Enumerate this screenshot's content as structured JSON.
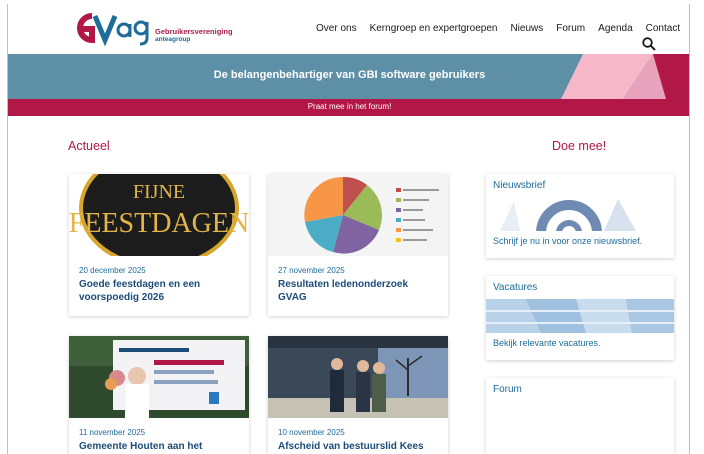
{
  "header": {
    "logo_sub1": "Gebruikersvereniging",
    "logo_sub2": "anteagroup",
    "nav": [
      "Over ons",
      "Kerngroep en expertgroepen",
      "Nieuws",
      "Forum",
      "Agenda",
      "Contact"
    ]
  },
  "banner": {
    "title": "De belangenbehartiger van GBI software gebruikers",
    "forum_link": "Praat mee in het forum!"
  },
  "sections": {
    "actueel": "Actueel",
    "doe_mee": "Doe mee!"
  },
  "news": [
    {
      "date": "20 december 2025",
      "title": "Goede feestdagen en een voorspoedig 2026",
      "image_text": [
        "FIJNE",
        "FEESTDAGEN"
      ]
    },
    {
      "date": "27 november 2025",
      "title": "Resultaten ledenonderzoek GVAG"
    },
    {
      "date": "11 november 2025",
      "title": "Gemeente Houten aan het"
    },
    {
      "date": "10 november 2025",
      "title": "Afscheid van bestuurslid Kees"
    }
  ],
  "sidebar": [
    {
      "title": "Nieuwsbrief",
      "text": "Schrijf je nu in voor onze nieuwsbrief."
    },
    {
      "title": "Vacatures",
      "text": "Bekijk relevante vacatures."
    },
    {
      "title": "Forum",
      "text": ""
    }
  ],
  "colors": {
    "brand_red": "#b11747",
    "banner_blue": "#5d8fa7",
    "link_blue": "#1d6c9a"
  }
}
